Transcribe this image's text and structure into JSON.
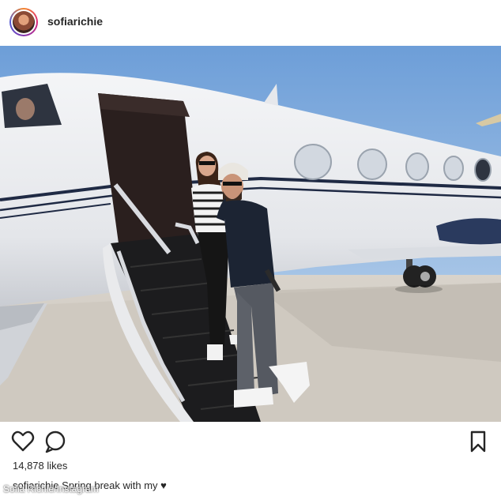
{
  "post": {
    "username": "sofiarichie",
    "likes": "14,878 likes",
    "caption_user": "sofiarichie",
    "caption_text": "Spring break with my ♥"
  },
  "photo_credit": "Sofia Richie/Instagram",
  "icons": {
    "like": "heart-outline-icon",
    "comment": "comment-bubble-icon",
    "save": "bookmark-icon"
  },
  "colors": {
    "text": "#262626",
    "story_ring_start": "#f58529",
    "story_ring_end": "#515bd4"
  }
}
